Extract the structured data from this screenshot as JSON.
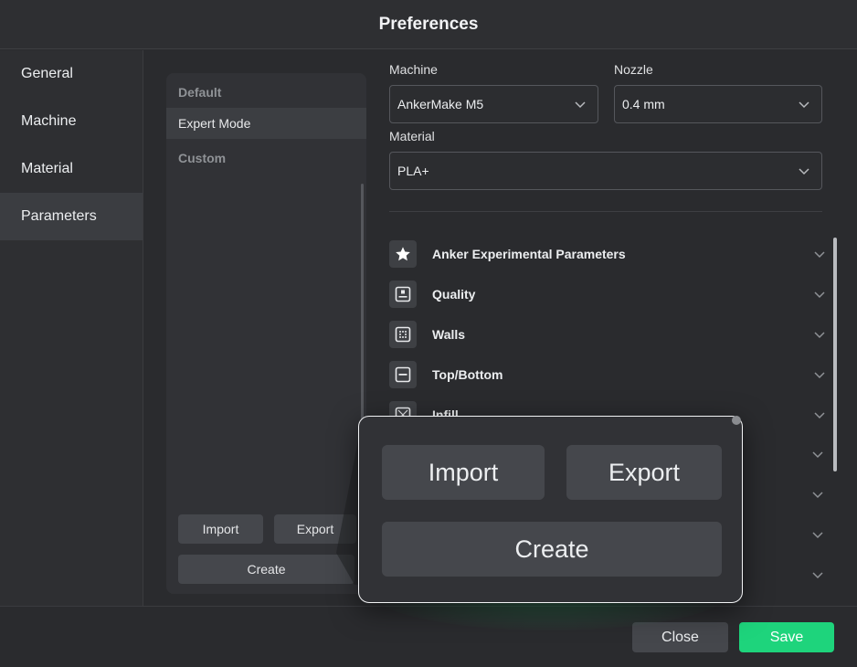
{
  "window": {
    "title": "Preferences"
  },
  "sidebar": {
    "items": [
      {
        "label": "General"
      },
      {
        "label": "Machine"
      },
      {
        "label": "Material"
      },
      {
        "label": "Parameters"
      }
    ],
    "active": "Parameters"
  },
  "profiles": {
    "items": [
      {
        "label": "Default",
        "kind": "section"
      },
      {
        "label": "Expert Mode",
        "kind": "selected"
      },
      {
        "label": "Custom",
        "kind": "section"
      }
    ],
    "import_label": "Import",
    "export_label": "Export",
    "create_label": "Create"
  },
  "selectors": {
    "machine": {
      "label": "Machine",
      "value": "AnkerMake M5"
    },
    "nozzle": {
      "label": "Nozzle",
      "value": "0.4 mm"
    },
    "material": {
      "label": "Material",
      "value": "PLA+"
    }
  },
  "parameter_groups": [
    {
      "label": "Anker Experimental Parameters",
      "icon": "star-icon"
    },
    {
      "label": "Quality",
      "icon": "quality-icon"
    },
    {
      "label": "Walls",
      "icon": "walls-icon"
    },
    {
      "label": "Top/Bottom",
      "icon": "top-bottom-icon"
    },
    {
      "label": "Infill",
      "icon": "infill-icon"
    }
  ],
  "zoom_callout": {
    "import_label": "Import",
    "export_label": "Export",
    "create_label": "Create"
  },
  "footer": {
    "close_label": "Close",
    "save_label": "Save"
  },
  "colors": {
    "accent": "#1ed47c",
    "background": "#2a2b2e",
    "panel": "#313236"
  }
}
